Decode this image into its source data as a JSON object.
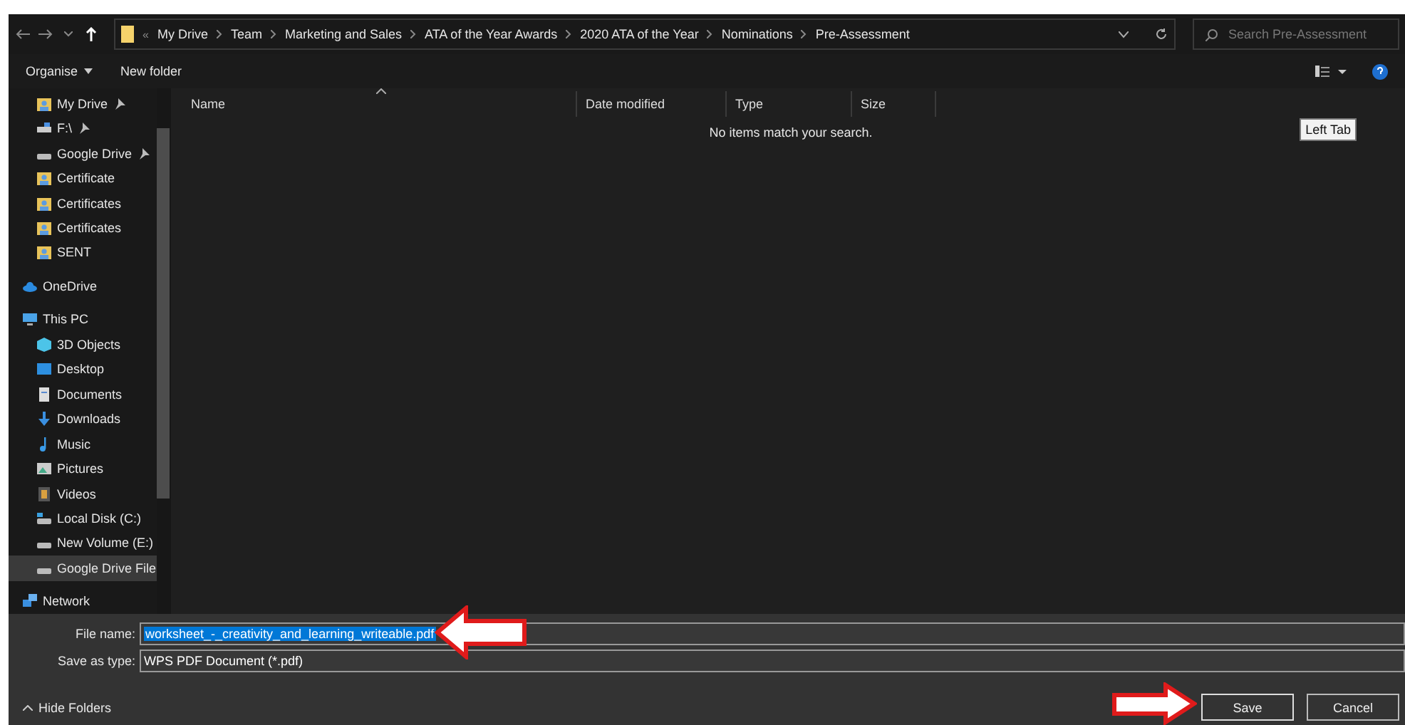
{
  "address_bar": {
    "overflow": "«",
    "crumbs": [
      "My Drive",
      "Team",
      "Marketing and Sales",
      "ATA of the Year Awards",
      "2020 ATA of the Year",
      "Nominations",
      "Pre-Assessment"
    ]
  },
  "search": {
    "placeholder": "Search Pre-Assessment"
  },
  "toolbar": {
    "organise": "Organise",
    "new_folder": "New folder"
  },
  "sidebar": {
    "quick_items": [
      {
        "label": "My Drive",
        "kind": "drive-folder",
        "pinned": true,
        "selected": false
      },
      {
        "label": "F:\\",
        "kind": "net-drive",
        "pinned": true,
        "selected": false
      },
      {
        "label": "Google Drive",
        "kind": "disk",
        "pinned": true,
        "selected": false
      },
      {
        "label": "Certificate",
        "kind": "drive-folder",
        "pinned": false,
        "selected": false
      },
      {
        "label": "Certificates",
        "kind": "drive-folder",
        "pinned": false,
        "selected": false
      },
      {
        "label": "Certificates",
        "kind": "drive-folder",
        "pinned": false,
        "selected": false
      },
      {
        "label": "SENT",
        "kind": "drive-folder",
        "pinned": false,
        "selected": false
      }
    ],
    "items": [
      {
        "label": "OneDrive",
        "kind": "cloud",
        "selected": false
      },
      {
        "label": "This PC",
        "kind": "pc",
        "selected": false,
        "children": [
          {
            "label": "3D Objects",
            "kind": "cube",
            "selected": false
          },
          {
            "label": "Desktop",
            "kind": "desktop",
            "selected": false
          },
          {
            "label": "Documents",
            "kind": "document",
            "selected": false
          },
          {
            "label": "Downloads",
            "kind": "download",
            "selected": false
          },
          {
            "label": "Music",
            "kind": "music",
            "selected": false
          },
          {
            "label": "Pictures",
            "kind": "pictures",
            "selected": false
          },
          {
            "label": "Videos",
            "kind": "video",
            "selected": false
          },
          {
            "label": "Local Disk (C:)",
            "kind": "system-disk",
            "selected": false
          },
          {
            "label": "New Volume (E:)",
            "kind": "disk",
            "selected": false
          },
          {
            "label": "Google Drive File",
            "kind": "disk",
            "selected": true
          }
        ]
      },
      {
        "label": "Network",
        "kind": "network",
        "selected": false
      }
    ]
  },
  "file_list": {
    "columns": [
      {
        "label": "Name",
        "sorted": true
      },
      {
        "label": "Date modified",
        "sorted": false
      },
      {
        "label": "Type",
        "sorted": false
      },
      {
        "label": "Size",
        "sorted": false
      }
    ],
    "empty_message": "No items match your search."
  },
  "tooltip": "Left Tab",
  "form": {
    "file_name_label": "File name:",
    "file_name": "worksheet_-_creativity_and_learning_writeable.pdf",
    "file_name_selected": true,
    "type_label": "Save as type:",
    "type": "WPS PDF Document (*.pdf)"
  },
  "hide_folders": "Hide Folders",
  "buttons": [
    "Save",
    "Cancel"
  ]
}
